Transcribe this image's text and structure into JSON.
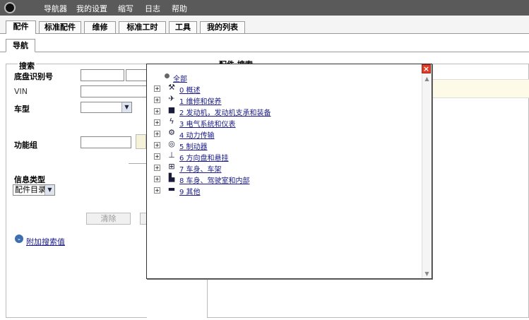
{
  "menubar": {
    "items": [
      "导航器",
      "我的设置",
      "缩写",
      "日志",
      "帮助"
    ]
  },
  "tabs": [
    "配件",
    "标准配件",
    "维修",
    "标准工时",
    "工具",
    "我的列表"
  ],
  "subtab": "导航",
  "search_panel": {
    "title": "搜索",
    "chassis_label": "底盘识别号",
    "vin_label": "VIN",
    "model_label": "车型",
    "function_group_label": "功能组",
    "info_type_label": "信息类型",
    "info_type_value": "配件目录",
    "clear_button": "清除",
    "additional_search_label": "附加搜索值"
  },
  "right_panel": {
    "title": "配件 搜索"
  },
  "tree": {
    "root": "全部",
    "items": [
      {
        "label": "0 概述",
        "icon": "wrench-icon"
      },
      {
        "label": "1 维修和保养",
        "icon": "service-icon"
      },
      {
        "label": "2 发动机，发动机支承和装备",
        "icon": "engine-icon"
      },
      {
        "label": "3 电气系统和仪表",
        "icon": "electrical-icon"
      },
      {
        "label": "4 动力传输",
        "icon": "gears-icon"
      },
      {
        "label": "5 制动器",
        "icon": "brake-icon"
      },
      {
        "label": "6 方向盘和悬挂",
        "icon": "steering-icon"
      },
      {
        "label": "7 车身、车架",
        "icon": "frame-icon"
      },
      {
        "label": "8 车身、驾驶室和内部",
        "icon": "cab-icon"
      },
      {
        "label": "9 其他",
        "icon": "truck-icon"
      }
    ]
  },
  "colors": {
    "menubar_bg": "#5a5a5a",
    "link": "#1a1a8a",
    "close_button": "#e03c22"
  }
}
